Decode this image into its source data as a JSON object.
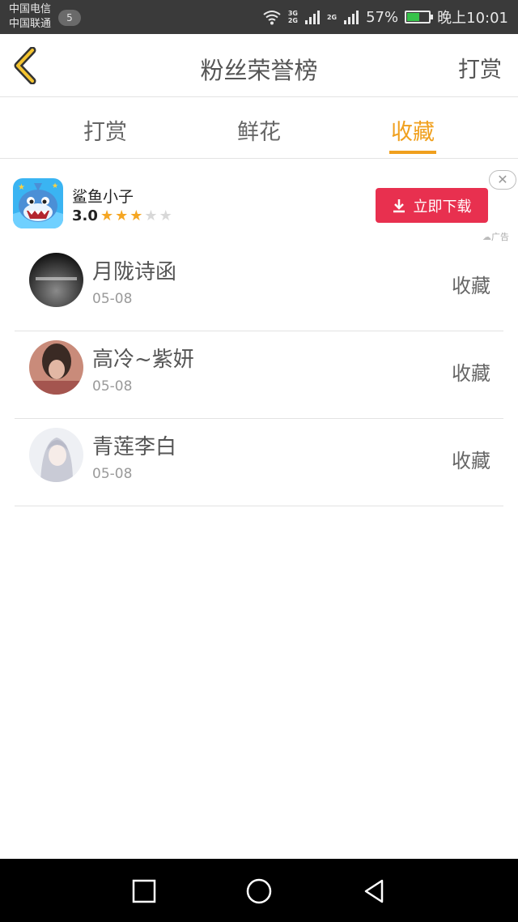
{
  "status_bar": {
    "carrier_1": "中国电信",
    "carrier_2": "中国联通",
    "notification_count": "5",
    "net_1": "3G",
    "net_2": "2G",
    "net_3": "2G",
    "battery_percent": "57%",
    "battery_level": 0.57,
    "time": "晚上10:01"
  },
  "header": {
    "title": "粉丝荣誉榜",
    "action": "打赏",
    "back_icon": "chevron-left-icon"
  },
  "tabs": [
    {
      "label": "打赏",
      "active": false
    },
    {
      "label": "鲜花",
      "active": false
    },
    {
      "label": "收藏",
      "active": true
    }
  ],
  "ad": {
    "app_name": "鲨鱼小子",
    "rating": "3.0",
    "stars_filled": 3,
    "stars_total": 5,
    "button_label": "立即下载",
    "close_glyph": "✕",
    "label": "广告"
  },
  "list": [
    {
      "name": "月陇诗函",
      "date": "05-08",
      "action": "收藏"
    },
    {
      "name": "高冷~紫妍",
      "date": "05-08",
      "action": "收藏"
    },
    {
      "name": "青莲李白",
      "date": "05-08",
      "action": "收藏"
    }
  ],
  "colors": {
    "accent": "#f0a01e",
    "ad_button": "#e8304f",
    "status_bar": "#3a3a3a"
  }
}
